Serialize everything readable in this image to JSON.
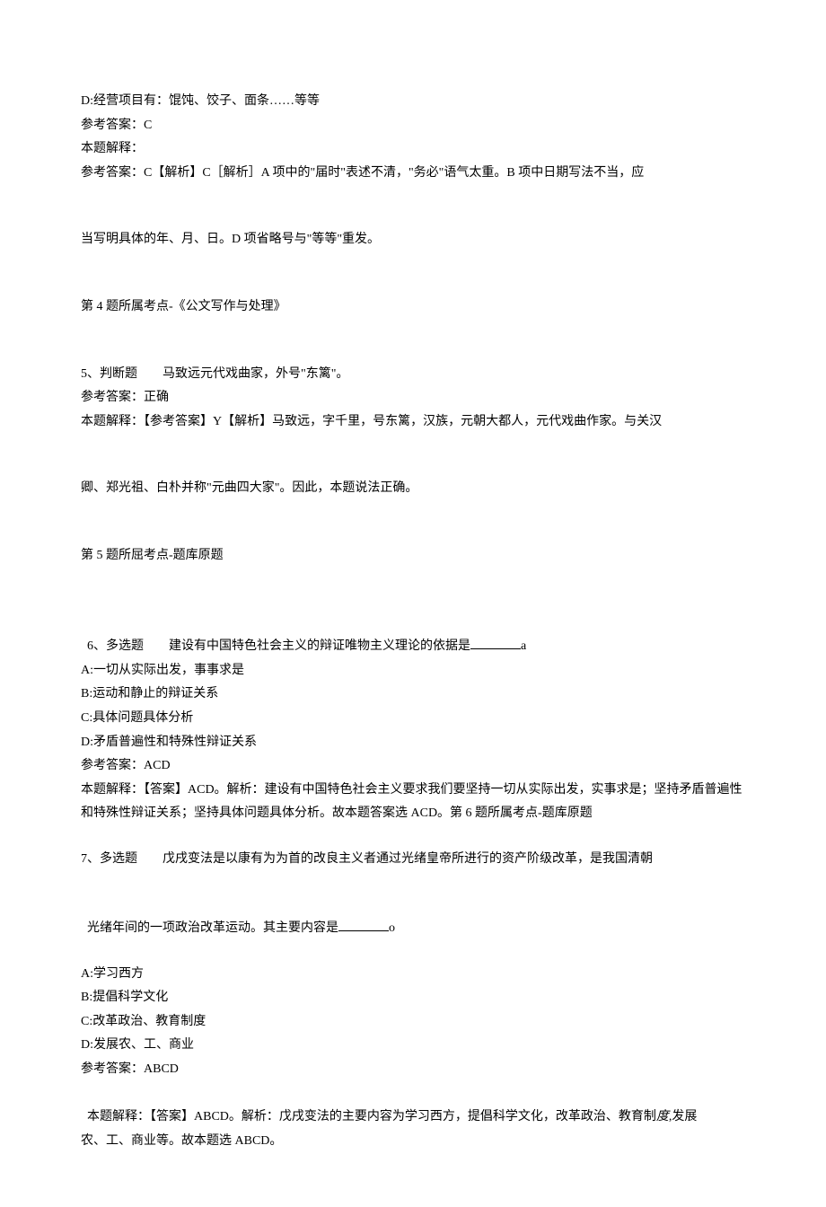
{
  "q3_continued": {
    "option_d": "D:经营项目有：馄饨、饺子、面条……等等",
    "answer_label": "参考答案：C",
    "explain_label": "本题解释：",
    "explain_line1": "参考答案：C【解析】C［解析］A 项中的\"届时\"表述不清，\"务必\"语气太重。B 项中日期写法不当，应",
    "explain_line2": "当写明具体的年、月、日。D 项省略号与\"等等\"重发。",
    "topic": "第 4 题所属考点-《公文写作与处理》"
  },
  "q5": {
    "stem": "5、判断题　　马致远元代戏曲家，外号\"东篱\"。",
    "answer": "参考答案：正确",
    "explain_line1": "本题解释：【参考答案】Y【解析】马致远，字千里，号东篱，汉族，元朝大都人，元代戏曲作家。与关汉",
    "explain_line2": "卿、郑光祖、白朴并称\"元曲四大家\"。因此，本题说法正确。",
    "topic": "第 5 题所屈考点-题库原题"
  },
  "q6": {
    "stem_prefix": "6、多选题　　建设有中国特色社会主义的辩证唯物主义理论的依据是",
    "stem_suffix": "a",
    "opt_a": "A:一切从实际出发，事事求是",
    "opt_b": "B:运动和静止的辩证关系",
    "opt_c": "C:具体问题具体分析",
    "opt_d": "D:矛盾普遍性和特殊性辩证关系",
    "answer": "参考答案：ACD",
    "explain": "本题解释：【答案】ACD。解析：建设有中国特色社会主义要求我们要坚持一切从实际出发，实事求是；坚持矛盾普遍性和特殊性辩证关系；坚持具体问题具体分析。故本题答案选 ACD。第 6 题所属考点-题库原题"
  },
  "q7": {
    "stem_line1": "7、多选题　　戊戌变法是以康有为为首的改良主义者通过光绪皇帝所进行的资产阶级改革，是我国清朝",
    "stem_line2_prefix": "光绪年间的一项政治改革运动。其主要内容是",
    "stem_line2_suffix": "o",
    "opt_a": "A:学习西方",
    "opt_b": "B:提倡科学文化",
    "opt_c": "C:改革政治、教育制度",
    "opt_d": "D:发展农、工、商业",
    "answer": "参考答案：ABCD",
    "explain_line1_a": "本题解释：【答案】ABCD。解析：戊戌变法的主要内容为学习西方，提倡科学文化，改革政治、教育制",
    "explain_line1_b": "度",
    "explain_line1_c": ",发展",
    "explain_line2": "农、工、商业等。故本题选 ABCD。"
  }
}
